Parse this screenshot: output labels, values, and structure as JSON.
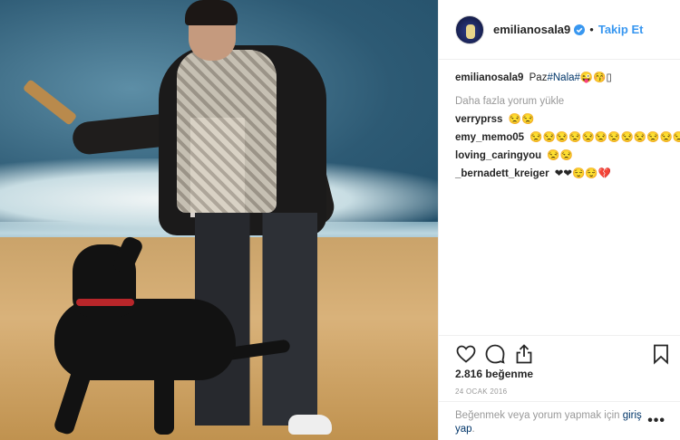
{
  "post": {
    "image_alt_icon": "beach-photo",
    "username": "emilianosala9",
    "separator": "•",
    "follow_label": "Takip Et",
    "caption": {
      "user": "emilianosala9",
      "text_prefix": "Paz",
      "hashtag": "#Nala#",
      "emoji": "😜😚▯"
    },
    "load_more": "Daha fazla yorum yükle",
    "comments": [
      {
        "user": "verryprss",
        "text": "😒😒"
      },
      {
        "user": "emy_memo05",
        "text": "😒😒😒😒😒😒😒😒😒😒😒😒"
      },
      {
        "user": "loving_caringyou",
        "text": "😒😒"
      },
      {
        "user": "_bernadett_kreiger",
        "text": "❤❤😌😌💔"
      }
    ],
    "likes": "2.816 beğenme",
    "date": "24 OCAK 2016",
    "login_prompt": {
      "text": "Beğenmek veya yorum yapmak için ",
      "link": "giriş yap",
      "suffix": "."
    },
    "more_label": "•••"
  },
  "colors": {
    "accent": "#3897f0",
    "link": "#003569",
    "muted": "#999999",
    "text": "#262626"
  }
}
